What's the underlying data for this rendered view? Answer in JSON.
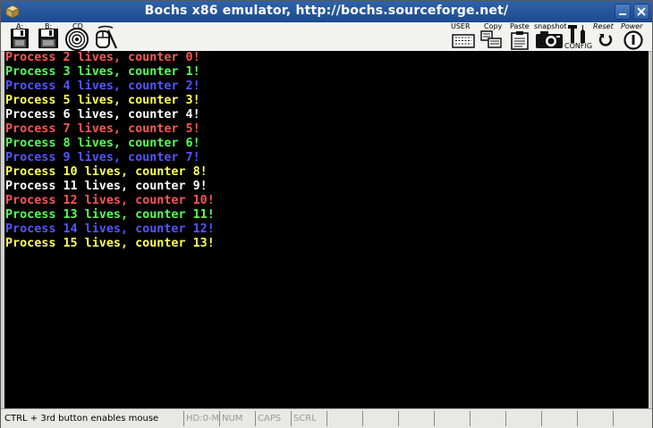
{
  "window": {
    "title": "Bochs x86 emulator, http://bochs.sourceforge.net/"
  },
  "toolbar": {
    "floppy_a_label": "A:",
    "floppy_b_label": "B:",
    "cdrom_label": "CD",
    "user_label": "USER",
    "copy_label": "Copy",
    "paste_label": "Paste",
    "snapshot_label": "snapshot",
    "config_label": "CONFIG",
    "reset_label": "Reset",
    "power_label": "Power"
  },
  "console": {
    "lines": [
      {
        "text": "Process 2 lives, counter 0!",
        "color": "#ff5555"
      },
      {
        "text": "Process 3 lives, counter 1!",
        "color": "#55ff55"
      },
      {
        "text": "Process 4 lives, counter 2!",
        "color": "#5555ff"
      },
      {
        "text": "Process 5 lives, counter 3!",
        "color": "#ffff55"
      },
      {
        "text": "Process 6 lives, counter 4!",
        "color": "#ffffff"
      },
      {
        "text": "Process 7 lives, counter 5!",
        "color": "#ff5555"
      },
      {
        "text": "Process 8 lives, counter 6!",
        "color": "#55ff55"
      },
      {
        "text": "Process 9 lives, counter 7!",
        "color": "#5555ff"
      },
      {
        "text": "Process 10 lives, counter 8!",
        "color": "#ffff55"
      },
      {
        "text": "Process 11 lives, counter 9!",
        "color": "#ffffff"
      },
      {
        "text": "Process 12 lives, counter 10!",
        "color": "#ff5555"
      },
      {
        "text": "Process 13 lives, counter 11!",
        "color": "#55ff55"
      },
      {
        "text": "Process 14 lives, counter 12!",
        "color": "#5555ff"
      },
      {
        "text": "Process 15 lives, counter 13!",
        "color": "#ffff55"
      }
    ]
  },
  "statusbar": {
    "hint": "CTRL + 3rd button enables mouse",
    "hd": "HD:0-M",
    "num": "NUM",
    "caps": "CAPS",
    "scrl": "SCRL"
  }
}
